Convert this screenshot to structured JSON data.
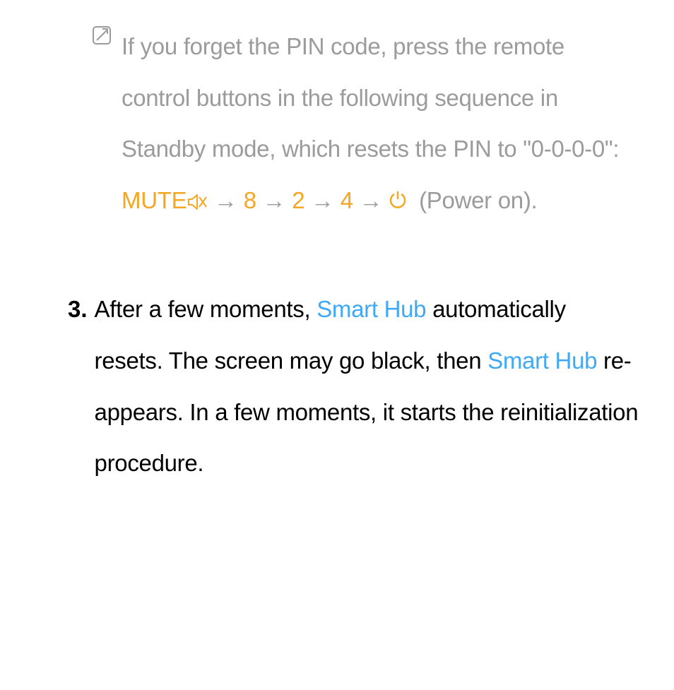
{
  "note": {
    "part1": "If you forget the PIN code, press the remote control buttons in the following sequence in Standby mode, which resets the PIN to \"0-0-0-0\": ",
    "mute_label": "MUTE",
    "arrow": " → ",
    "d8": "8",
    "d2": "2",
    "d4": "4",
    "arrow_trail": " →",
    "power_tail": " (Power on).",
    "colors": {
      "orange": "#f5a623",
      "grey": "#9b9b9b"
    }
  },
  "item3": {
    "num": "3.",
    "t1": "After a few moments, ",
    "smart_hub": "Smart Hub",
    "t2": " automatically resets. The screen may go black, then ",
    "t3": " re-appears. In a few moments, it starts the reinitialization procedure.",
    "colors": {
      "blue": "#3fa9f5"
    }
  }
}
